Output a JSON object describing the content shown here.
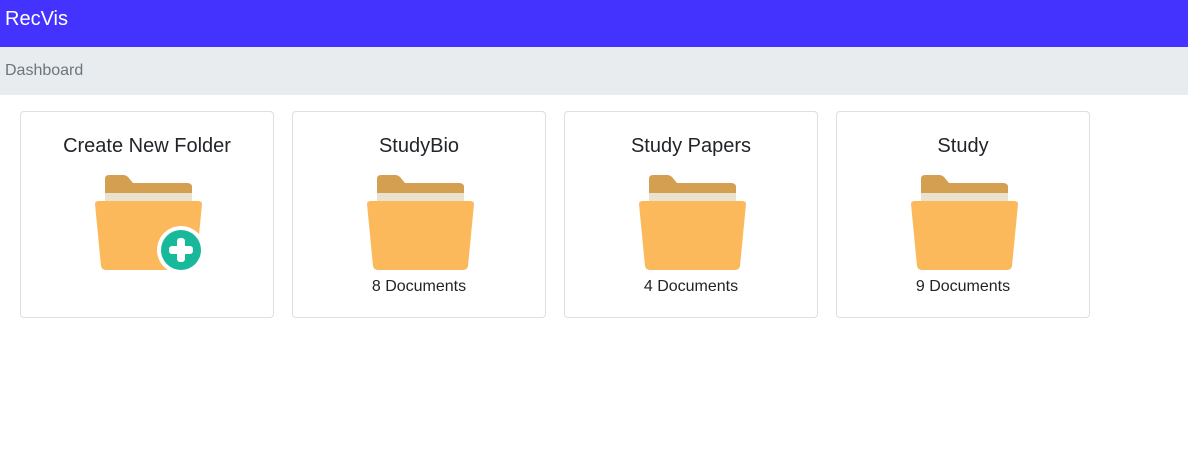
{
  "navbar": {
    "brand": "RecVis",
    "color": "#4433ff"
  },
  "breadcrumb": {
    "items": [
      {
        "label": "Dashboard"
      }
    ]
  },
  "folders": [
    {
      "title": "Create New Folder",
      "count": "",
      "icon": "folder-add-icon"
    },
    {
      "title": "StudyBio",
      "count": "8 Documents",
      "icon": "folder-icon"
    },
    {
      "title": "Study Papers",
      "count": "4 Documents",
      "icon": "folder-icon"
    },
    {
      "title": "Study",
      "count": "9 Documents",
      "icon": "folder-icon"
    }
  ],
  "colors": {
    "folder_back": "#d49f51",
    "folder_paper": "#e8e2cf",
    "folder_front": "#fbb95c",
    "add_badge": "#18b99a"
  }
}
